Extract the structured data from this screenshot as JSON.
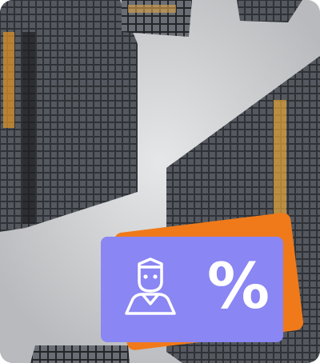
{
  "image": {
    "subject": "skyscrapers-from-below",
    "sky_color": "#c9cacc",
    "building_color": "#2b2d31",
    "window_light_color": "#f0a62a"
  },
  "badge": {
    "back_color": "#f07a1a",
    "front_color": "#8a86f3",
    "icon": "user-icon",
    "symbol": "%"
  }
}
